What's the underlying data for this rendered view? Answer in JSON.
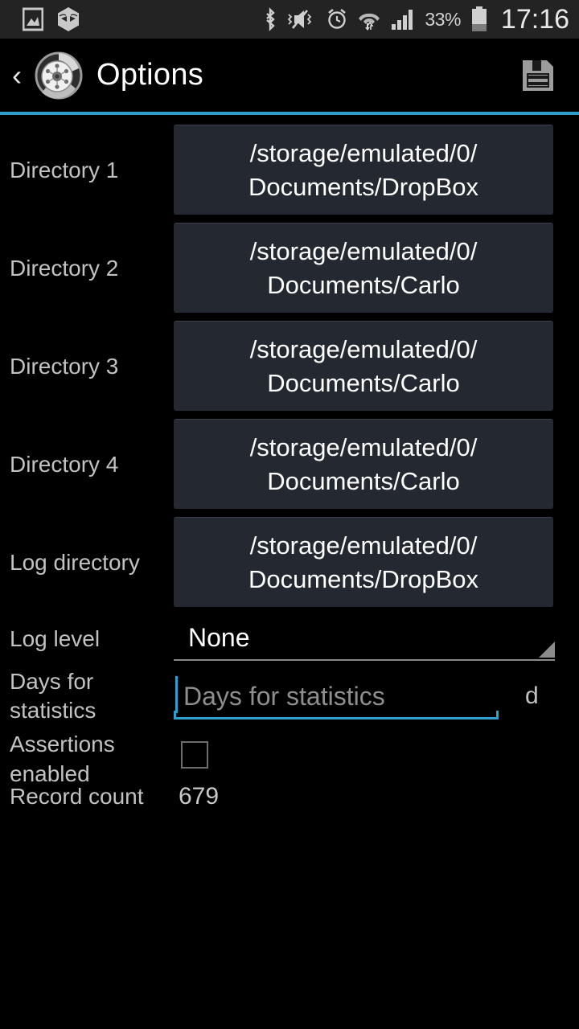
{
  "status_bar": {
    "left_icons": [
      "screenshot-image-icon",
      "hexagon-app-icon"
    ],
    "right_icons": [
      "bluetooth-icon",
      "vibrate-mute-icon",
      "alarm-icon",
      "wifi-icon",
      "signal-icon"
    ],
    "battery_percent": "33%",
    "clock": "17:16",
    "background_color": "#232323"
  },
  "action_bar": {
    "back_chevron": "‹",
    "app_icon": "tire-wheel-icon",
    "title": "Options",
    "save_icon": "floppy-disk-save-icon",
    "accent_color": "#2f9fd0"
  },
  "options": {
    "directories": [
      {
        "label": "Directory 1",
        "line1": "/storage/emulated/0/",
        "line2": "Documents/DropBox"
      },
      {
        "label": "Directory 2",
        "line1": "/storage/emulated/0/",
        "line2": "Documents/Carlo"
      },
      {
        "label": "Directory 3",
        "line1": "/storage/emulated/0/",
        "line2": "Documents/Carlo"
      },
      {
        "label": "Directory 4",
        "line1": "/storage/emulated/0/",
        "line2": "Documents/Carlo"
      },
      {
        "label": "Log directory",
        "line1": "/storage/emulated/0/",
        "line2": "Documents/DropBox"
      }
    ],
    "log_level": {
      "label": "Log level",
      "value": "None"
    },
    "days_for_statistics": {
      "label": "Days for statistics",
      "label_line1": "Days for",
      "label_line2": "statistics",
      "value": "",
      "placeholder": "Days for statistics",
      "unit": "d",
      "focused": true
    },
    "assertions": {
      "label": "Assertions enabled",
      "label_line1": "Assertions",
      "label_line2": "enabled",
      "checked": false
    },
    "record_count": {
      "label": "Record count",
      "value": "679"
    }
  }
}
